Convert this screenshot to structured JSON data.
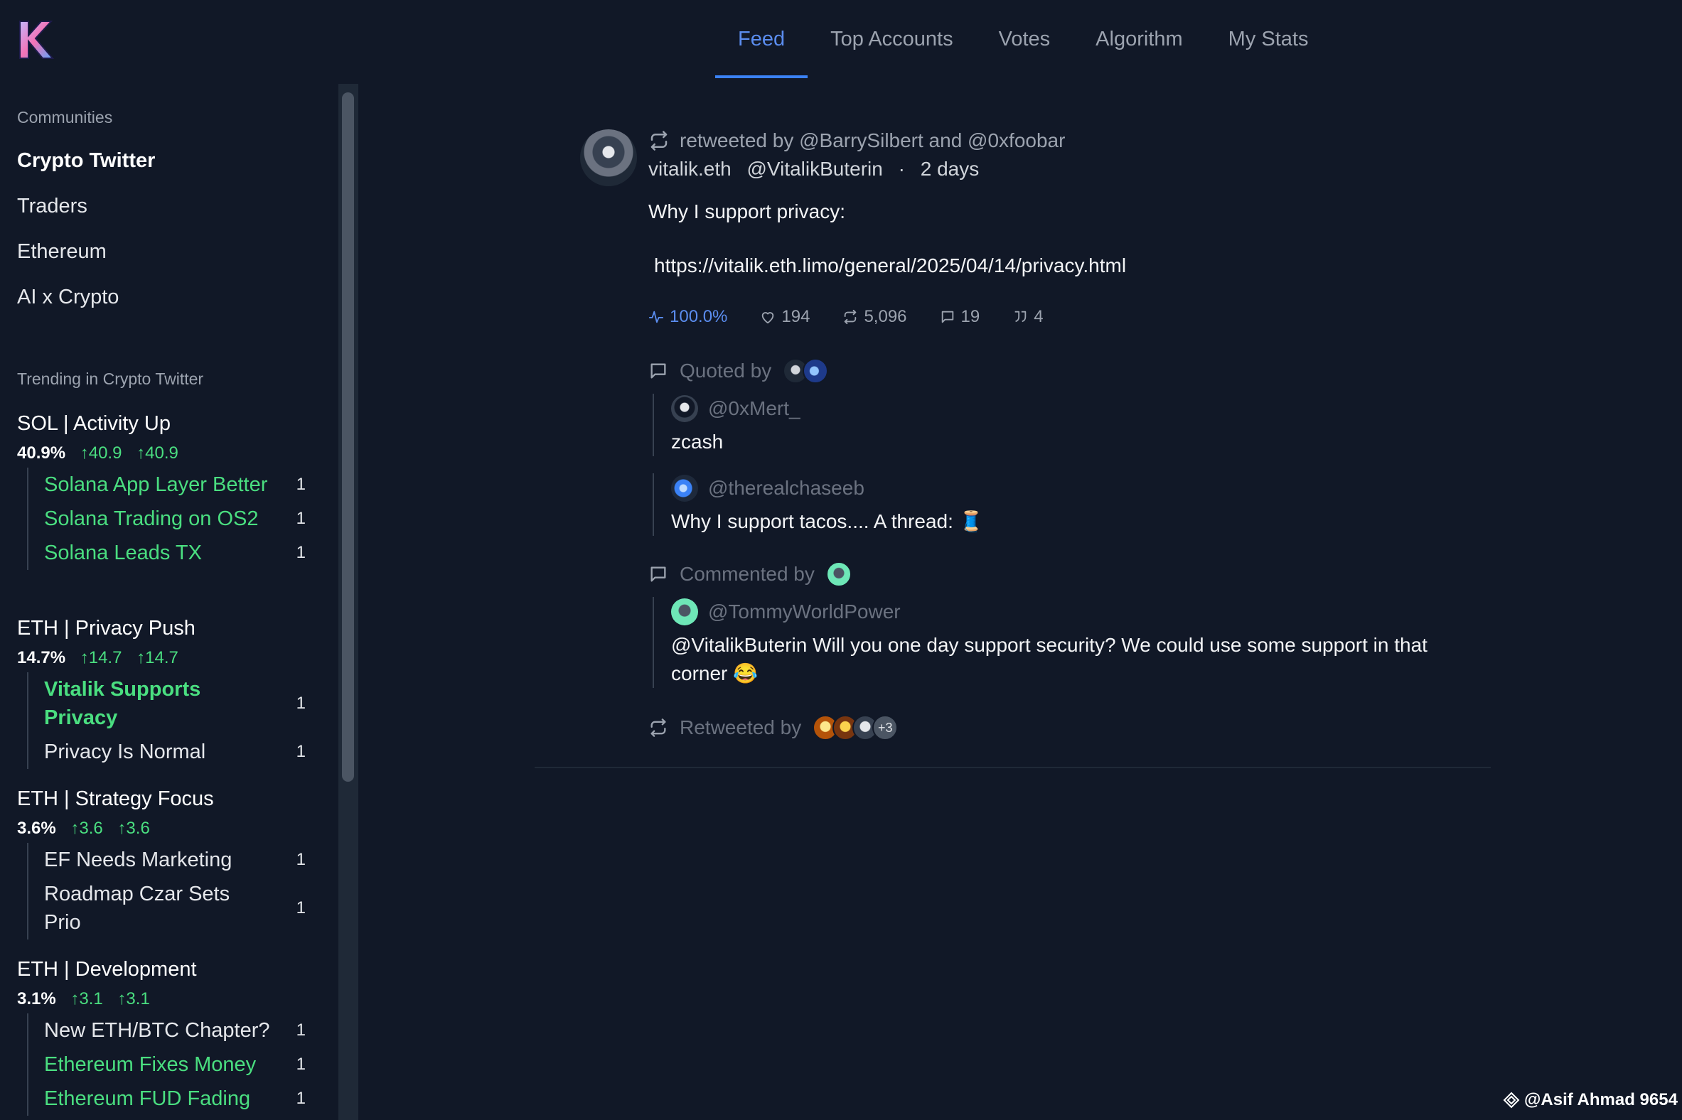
{
  "nav": {
    "tabs": [
      {
        "label": "Feed",
        "active": true
      },
      {
        "label": "Top Accounts"
      },
      {
        "label": "Votes"
      },
      {
        "label": "Algorithm"
      },
      {
        "label": "My Stats"
      }
    ]
  },
  "sidebar": {
    "communities_title": "Communities",
    "communities": [
      "Crypto Twitter",
      "Traders",
      "Ethereum",
      "AI x Crypto"
    ],
    "trending_title": "Trending in Crypto Twitter",
    "trends": [
      {
        "title": "SOL | Activity Up",
        "pct": "40.9%",
        "up1": "↑40.9",
        "up2": "↑40.9",
        "items": [
          {
            "label": "Solana App Layer Better",
            "count": "1"
          },
          {
            "label": "Solana Trading on OS2",
            "count": "1"
          },
          {
            "label": "Solana Leads TX",
            "count": "1"
          }
        ]
      },
      {
        "title": "ETH | Privacy Push",
        "pct": "14.7%",
        "up1": "↑14.7",
        "up2": "↑14.7",
        "items": [
          {
            "label": "Vitalik Supports Privacy",
            "count": "1"
          },
          {
            "label": "Privacy Is Normal",
            "count": "1"
          }
        ]
      },
      {
        "title": "ETH | Strategy Focus",
        "pct": "3.6%",
        "up1": "↑3.6",
        "up2": "↑3.6",
        "items": [
          {
            "label": "EF Needs Marketing",
            "count": "1"
          },
          {
            "label": "Roadmap Czar Sets Prio",
            "count": "1"
          }
        ]
      },
      {
        "title": "ETH | Development",
        "pct": "3.1%",
        "up1": "↑3.1",
        "up2": "↑3.1",
        "items": [
          {
            "label": "New ETH/BTC Chapter?",
            "count": "1"
          },
          {
            "label": "Ethereum Fixes Money",
            "count": "1"
          },
          {
            "label": "Ethereum FUD Fading",
            "count": "1"
          }
        ]
      }
    ]
  },
  "post": {
    "retweeted_by": "retweeted by @BarrySilbert and @0xfoobar",
    "author_name": "vitalik.eth",
    "author_handle": "@VitalikButerin",
    "dot": "·",
    "time": "2 days",
    "text": "Why I support privacy:",
    "link": "https://vitalik.eth.limo/general/2025/04/14/privacy.html",
    "metrics": {
      "score": "100.0%",
      "likes": "194",
      "retweets": "5,096",
      "replies": "19",
      "quotes": "4"
    },
    "quoted_by_label": "Quoted by",
    "quotes": [
      {
        "handle": "@0xMert_",
        "text": "zcash"
      },
      {
        "handle": "@therealchaseeb",
        "text": "Why I support tacos.... A thread: 🧵"
      }
    ],
    "commented_by_label": "Commented by",
    "comments": [
      {
        "handle": "@TommyWorldPower",
        "text": "@VitalikButerin Will you one day support security? We could use some support in that corner 😂"
      }
    ],
    "retweeted_by_label": "Retweeted by",
    "retweeted_more": "+3"
  },
  "credit": "@Asif Ahmad 9654",
  "colors": {
    "background": "#111827",
    "accent": "#3b82f6",
    "trend_green": "#4ade80"
  }
}
